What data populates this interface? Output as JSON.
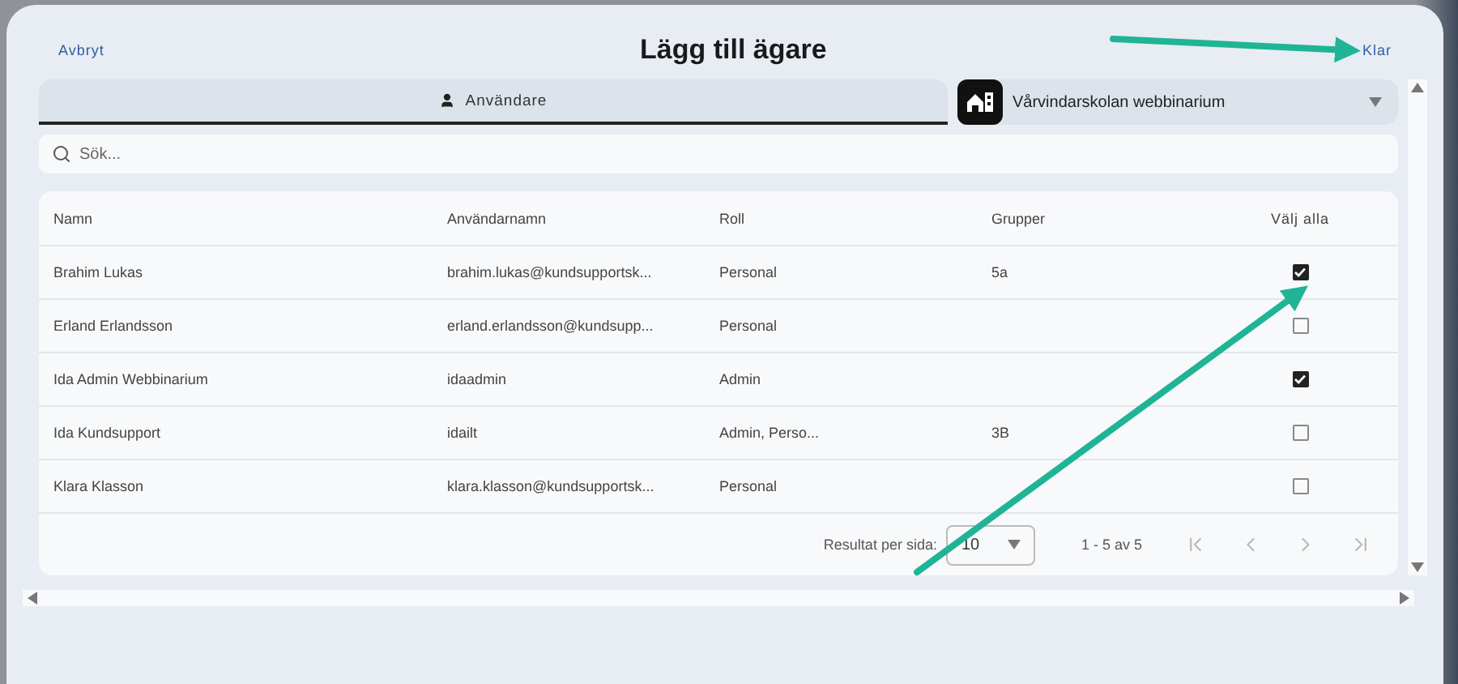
{
  "header": {
    "cancel": "Avbryt",
    "title": "Lägg till ägare",
    "done": "Klar"
  },
  "tabs": [
    {
      "label": "Användare",
      "selected": true
    }
  ],
  "school_select": {
    "value": "Vårvindarskolan webbinarium"
  },
  "search": {
    "placeholder": "Sök..."
  },
  "table": {
    "columns": [
      "Namn",
      "Användarnamn",
      "Roll",
      "Grupper"
    ],
    "select_all": "Välj alla",
    "rows": [
      {
        "cells": [
          "Brahim Lukas",
          "brahim.lukas@kundsupportsk...",
          "Personal",
          "5a"
        ],
        "checked": true
      },
      {
        "cells": [
          "Erland Erlandsson",
          "erland.erlandsson@kundsupp...",
          "Personal",
          ""
        ],
        "checked": false
      },
      {
        "cells": [
          "Ida Admin Webbinarium",
          "idaadmin",
          "Admin",
          ""
        ],
        "checked": true
      },
      {
        "cells": [
          "Ida Kundsupport",
          "idailt",
          "Admin, Perso...",
          "3B"
        ],
        "checked": false
      },
      {
        "cells": [
          "Klara Klasson",
          "klara.klasson@kundsupportsk...",
          "Personal",
          ""
        ],
        "checked": false
      }
    ]
  },
  "pagination": {
    "label": "Resultat per sida:",
    "page_size": "10",
    "range": "1 - 5 av 5"
  }
}
